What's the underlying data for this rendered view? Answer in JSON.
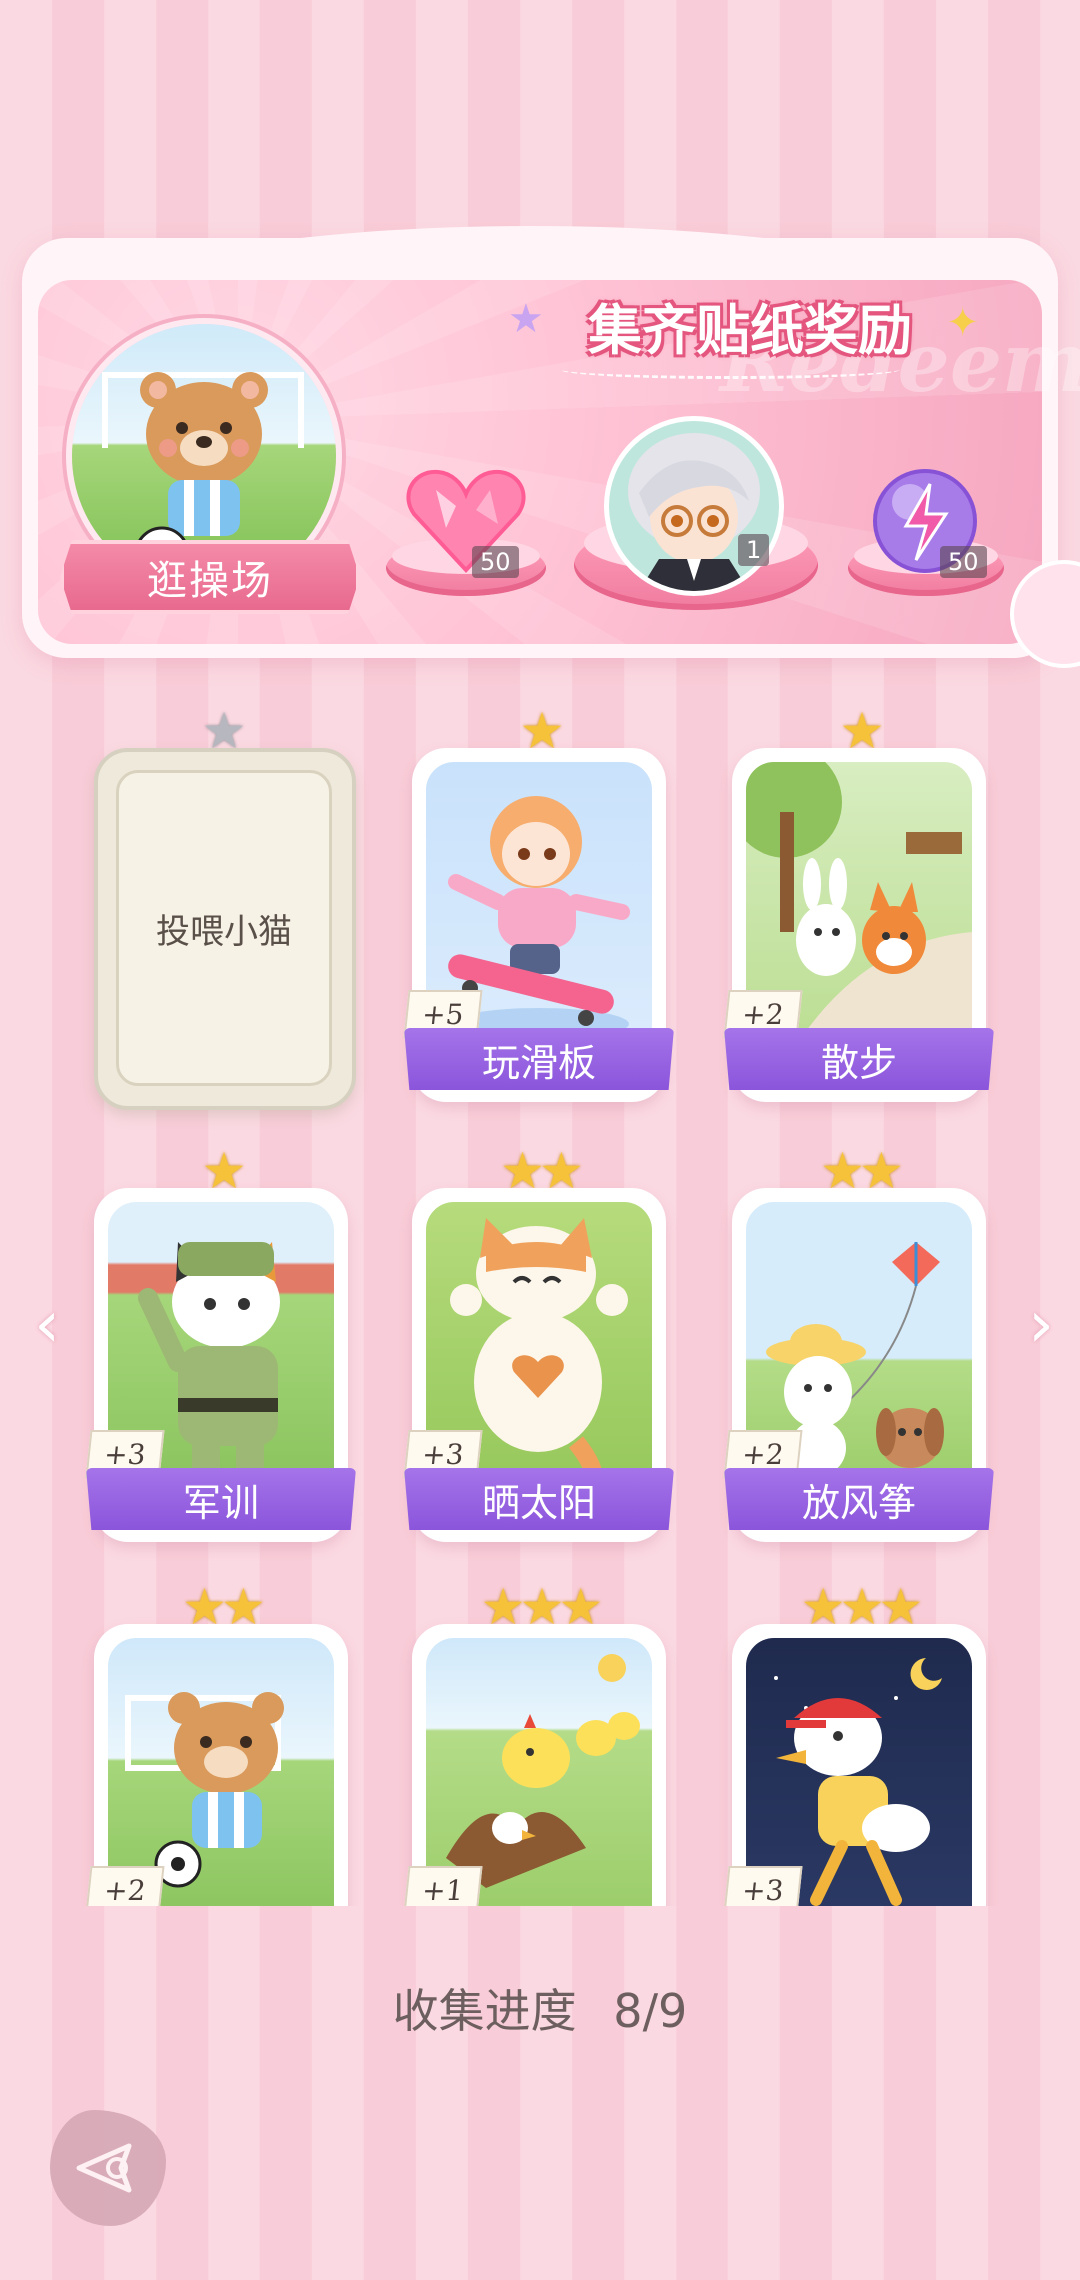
{
  "banner": {
    "title": "集齐贴纸奖励",
    "watermark": "Redeem",
    "place_label": "逛操场",
    "rewards": [
      {
        "icon": "pink-heart-gem-icon",
        "qty": "50"
      },
      {
        "icon": "character-avatar-icon",
        "qty": "1"
      },
      {
        "icon": "purple-energy-orb-icon",
        "qty": "50"
      }
    ]
  },
  "cards": [
    {
      "name": "投喂小猫",
      "stars": 1,
      "bonus": "",
      "locked": true
    },
    {
      "name": "玩滑板",
      "stars": 1,
      "bonus": "+5",
      "locked": false
    },
    {
      "name": "散步",
      "stars": 1,
      "bonus": "+2",
      "locked": false
    },
    {
      "name": "军训",
      "stars": 1,
      "bonus": "+3",
      "locked": false
    },
    {
      "name": "晒太阳",
      "stars": 2,
      "bonus": "+3",
      "locked": false
    },
    {
      "name": "放风筝",
      "stars": 2,
      "bonus": "+2",
      "locked": false
    },
    {
      "name": "",
      "stars": 2,
      "bonus": "+2",
      "locked": false
    },
    {
      "name": "",
      "stars": 3,
      "bonus": "+1",
      "locked": false
    },
    {
      "name": "",
      "stars": 3,
      "bonus": "+3",
      "locked": false
    }
  ],
  "progress": {
    "label": "收集进度",
    "value": "8/9"
  },
  "nav": {
    "prev": "‹",
    "next": "›"
  },
  "stars_glyph": {
    "one": "★",
    "two": "★★",
    "three": "★★★"
  }
}
